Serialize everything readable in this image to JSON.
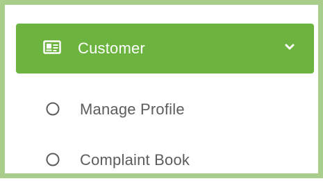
{
  "menu": {
    "header": {
      "label": "Customer",
      "icon": "id-card-icon",
      "expand_icon": "chevron-down-icon"
    },
    "items": [
      {
        "label": "Manage Profile",
        "icon": "circle-outline-icon"
      },
      {
        "label": "Complaint Book",
        "icon": "circle-outline-icon"
      }
    ]
  },
  "colors": {
    "accent": "#6cb43f",
    "frame": "#a9ce8c",
    "text": "#5c5c5c",
    "header_text": "#ffffff"
  }
}
